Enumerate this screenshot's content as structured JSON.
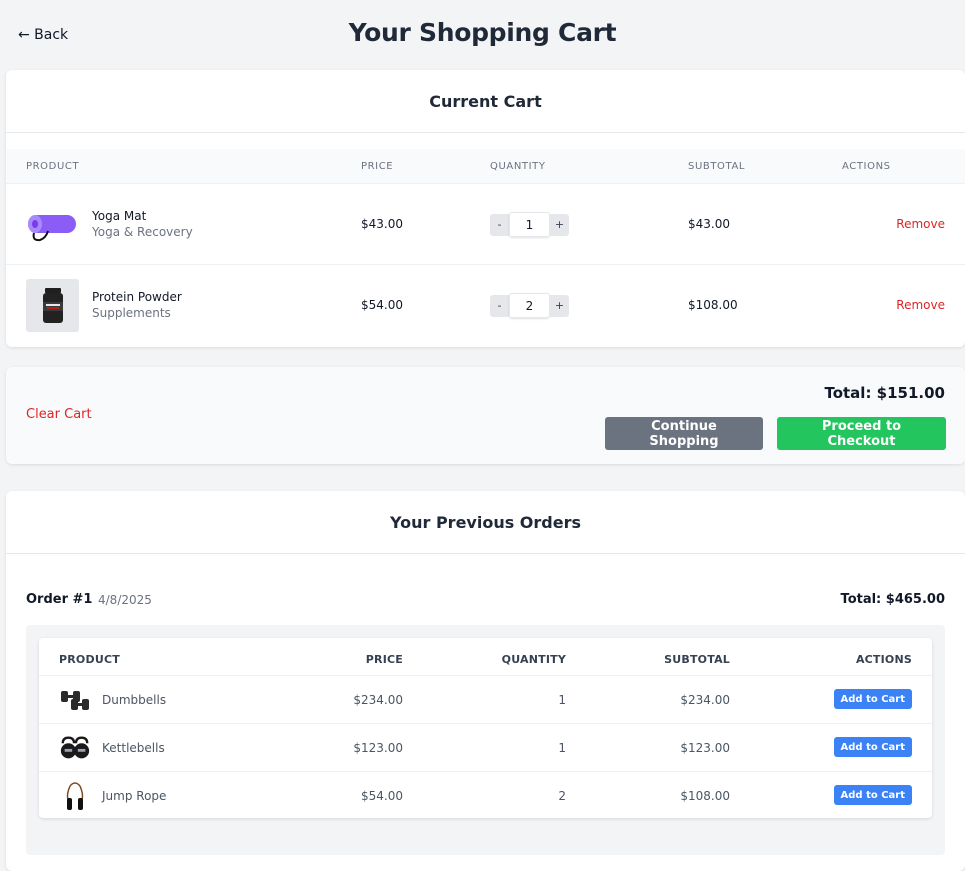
{
  "header": {
    "back_label": "← Back",
    "title": "Your Shopping Cart"
  },
  "current_cart": {
    "title": "Current Cart",
    "columns": [
      "PRODUCT",
      "PRICE",
      "QUANTITY",
      "SUBTOTAL",
      "ACTIONS"
    ],
    "items": [
      {
        "name": "Yoga Mat",
        "category": "Yoga & Recovery",
        "price": "$43.00",
        "quantity": "1",
        "subtotal": "$43.00",
        "action": "Remove",
        "icon": "yoga-mat-icon"
      },
      {
        "name": "Protein Powder",
        "category": "Supplements",
        "price": "$54.00",
        "quantity": "2",
        "subtotal": "$108.00",
        "action": "Remove",
        "icon": "protein-jar-icon"
      }
    ],
    "qty_minus": "-",
    "qty_plus": "+"
  },
  "cart_footer": {
    "clear_label": "Clear Cart",
    "total": "Total: $151.00",
    "continue_label": "Continue Shopping",
    "checkout_label": "Proceed to Checkout"
  },
  "previous_orders": {
    "title": "Your Previous Orders",
    "orders": [
      {
        "number": "Order #1",
        "date": "4/8/2025",
        "total": "Total: $465.00",
        "columns": [
          "PRODUCT",
          "PRICE",
          "QUANTITY",
          "SUBTOTAL",
          "ACTIONS"
        ],
        "items": [
          {
            "name": "Dumbbells",
            "price": "$234.00",
            "quantity": "1",
            "subtotal": "$234.00",
            "action": "Add to Cart",
            "icon": "dumbbells-icon"
          },
          {
            "name": "Kettlebells",
            "price": "$123.00",
            "quantity": "1",
            "subtotal": "$123.00",
            "action": "Add to Cart",
            "icon": "kettlebells-icon"
          },
          {
            "name": "Jump Rope",
            "price": "$54.00",
            "quantity": "2",
            "subtotal": "$108.00",
            "action": "Add to Cart",
            "icon": "jump-rope-icon"
          }
        ]
      }
    ]
  },
  "colors": {
    "remove": "#dc2626",
    "checkout": "#22c55e",
    "continue": "#6b7280",
    "add_to_cart": "#3b82f6"
  }
}
